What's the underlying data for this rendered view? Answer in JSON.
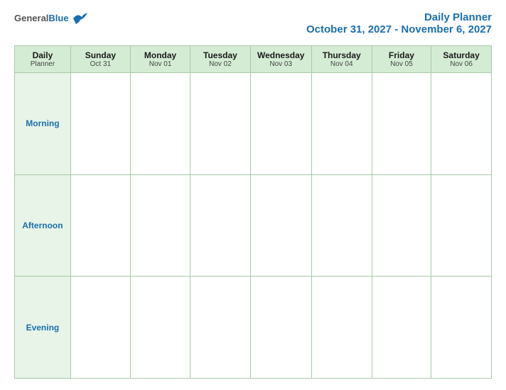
{
  "logo": {
    "text_general": "General",
    "text_blue": "Blue"
  },
  "title": {
    "line1": "Daily Planner",
    "line2": "October 31, 2027 - November 6, 2027"
  },
  "table": {
    "header_label_line1": "Daily",
    "header_label_line2": "Planner",
    "columns": [
      {
        "day": "Sunday",
        "date": "Oct 31"
      },
      {
        "day": "Monday",
        "date": "Nov 01"
      },
      {
        "day": "Tuesday",
        "date": "Nov 02"
      },
      {
        "day": "Wednesday",
        "date": "Nov 03"
      },
      {
        "day": "Thursday",
        "date": "Nov 04"
      },
      {
        "day": "Friday",
        "date": "Nov 05"
      },
      {
        "day": "Saturday",
        "date": "Nov 06"
      }
    ],
    "rows": [
      {
        "label": "Morning"
      },
      {
        "label": "Afternoon"
      },
      {
        "label": "Evening"
      }
    ]
  }
}
